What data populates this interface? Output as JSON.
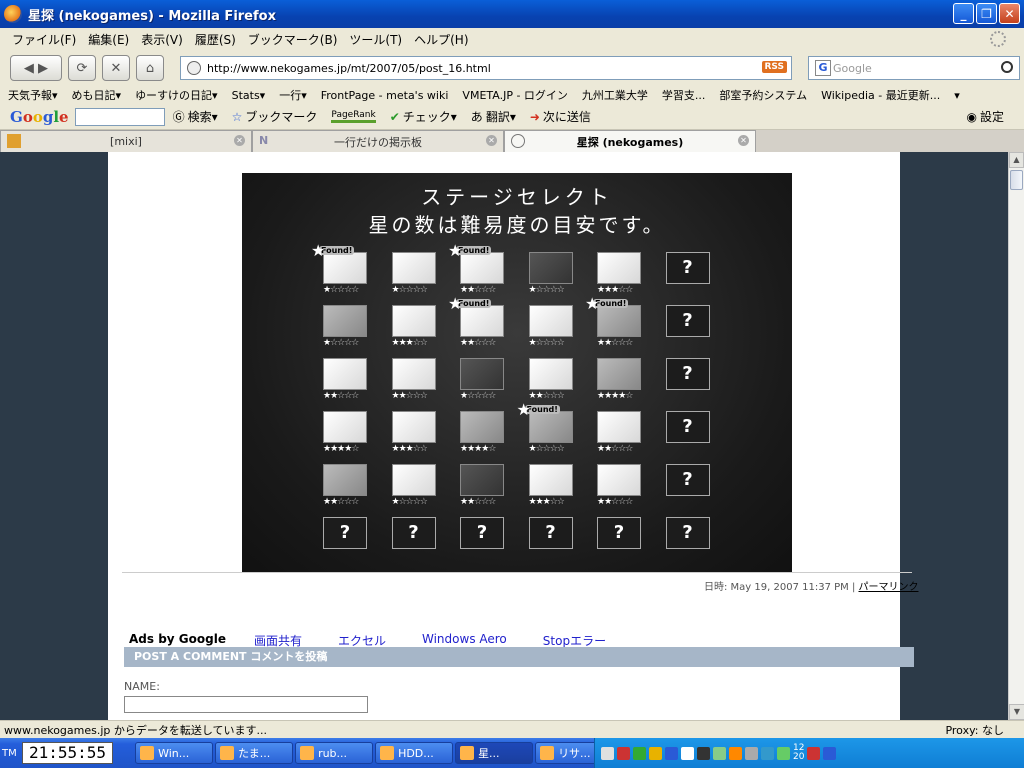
{
  "window": {
    "title": "星探 (nekogames) - Mozilla Firefox"
  },
  "menu": [
    "ファイル(F)",
    "編集(E)",
    "表示(V)",
    "履歴(S)",
    "ブックマーク(B)",
    "ツール(T)",
    "ヘルプ(H)"
  ],
  "nav": {
    "url": "http://www.nekogames.jp/mt/2007/05/post_16.html",
    "rss": "RSS",
    "search_placeholder": "Google"
  },
  "bookmarks": [
    "天気予報▾",
    "めも日記▾",
    "ゆーすけの日記▾",
    "Stats▾",
    "一行▾",
    "FrontPage - meta's wiki",
    "VMETA.JP - ログイン",
    "九州工業大学",
    "学習支...",
    "部室予約システム",
    "Wikipedia - 最近更新...",
    "▾"
  ],
  "gtoolbar": {
    "search": "検索▾",
    "bookmark": "ブックマーク",
    "pagerank": "PageRank",
    "check": "チェック▾",
    "translate": "翻訳▾",
    "send": "次に送信",
    "settings": "設定"
  },
  "tabs": [
    {
      "label": "[mixi]"
    },
    {
      "label": "一行だけの掲示板"
    },
    {
      "label": "星探 (nekogames)"
    }
  ],
  "stage": {
    "title": "ステージセレクト",
    "subtitle": "星の数は難易度の目安です。",
    "found_label": "Found!",
    "question": "?",
    "cells": [
      {
        "type": "light",
        "stars": 1,
        "found": true
      },
      {
        "type": "light",
        "stars": 1,
        "found": false
      },
      {
        "type": "light",
        "stars": 2,
        "found": true
      },
      {
        "type": "dark",
        "stars": 1,
        "found": false
      },
      {
        "type": "light",
        "stars": 3,
        "found": false
      },
      {
        "type": "q"
      },
      {
        "type": "mid",
        "stars": 1,
        "found": false
      },
      {
        "type": "light",
        "stars": 3,
        "found": false
      },
      {
        "type": "light",
        "stars": 2,
        "found": true
      },
      {
        "type": "light",
        "stars": 1,
        "found": false
      },
      {
        "type": "mid",
        "stars": 2,
        "found": true
      },
      {
        "type": "q"
      },
      {
        "type": "light",
        "stars": 2,
        "found": false
      },
      {
        "type": "light",
        "stars": 2,
        "found": false
      },
      {
        "type": "dark",
        "stars": 1,
        "found": false
      },
      {
        "type": "light",
        "stars": 2,
        "found": false
      },
      {
        "type": "mid",
        "stars": 4,
        "found": false
      },
      {
        "type": "q"
      },
      {
        "type": "light",
        "stars": 4,
        "found": false
      },
      {
        "type": "light",
        "stars": 3,
        "found": false
      },
      {
        "type": "mid",
        "stars": 4,
        "found": false
      },
      {
        "type": "mid",
        "stars": 1,
        "found": true
      },
      {
        "type": "light",
        "stars": 2,
        "found": false
      },
      {
        "type": "q"
      },
      {
        "type": "mid",
        "stars": 2,
        "found": false
      },
      {
        "type": "light",
        "stars": 1,
        "found": false
      },
      {
        "type": "dark",
        "stars": 2,
        "found": false
      },
      {
        "type": "light",
        "stars": 3,
        "found": false
      },
      {
        "type": "light",
        "stars": 2,
        "found": false
      },
      {
        "type": "q"
      },
      {
        "type": "q"
      },
      {
        "type": "q"
      },
      {
        "type": "q"
      },
      {
        "type": "q"
      },
      {
        "type": "q"
      },
      {
        "type": "q"
      }
    ]
  },
  "post": {
    "meta": "日時: May 19, 2007 11:37 PM | ",
    "permalink": "パーマリンク"
  },
  "ads": {
    "label": "Ads by Google",
    "links": [
      "画面共有",
      "エクセル",
      "Windows Aero",
      "Stopエラー"
    ]
  },
  "comment": {
    "header": "POST A COMMENT コメントを投稿",
    "name_label": "NAME:"
  },
  "status": {
    "text": "www.nekogames.jp からデータを転送しています...",
    "proxy": "Proxy: なし"
  },
  "taskbar": {
    "tm": "TM",
    "clock": "21:55:55",
    "tasks": [
      "Win...",
      "たま...",
      "rub...",
      "HDD...",
      "星...",
      "リサ..."
    ],
    "active_task": 4,
    "tray_time": "12\n20"
  }
}
